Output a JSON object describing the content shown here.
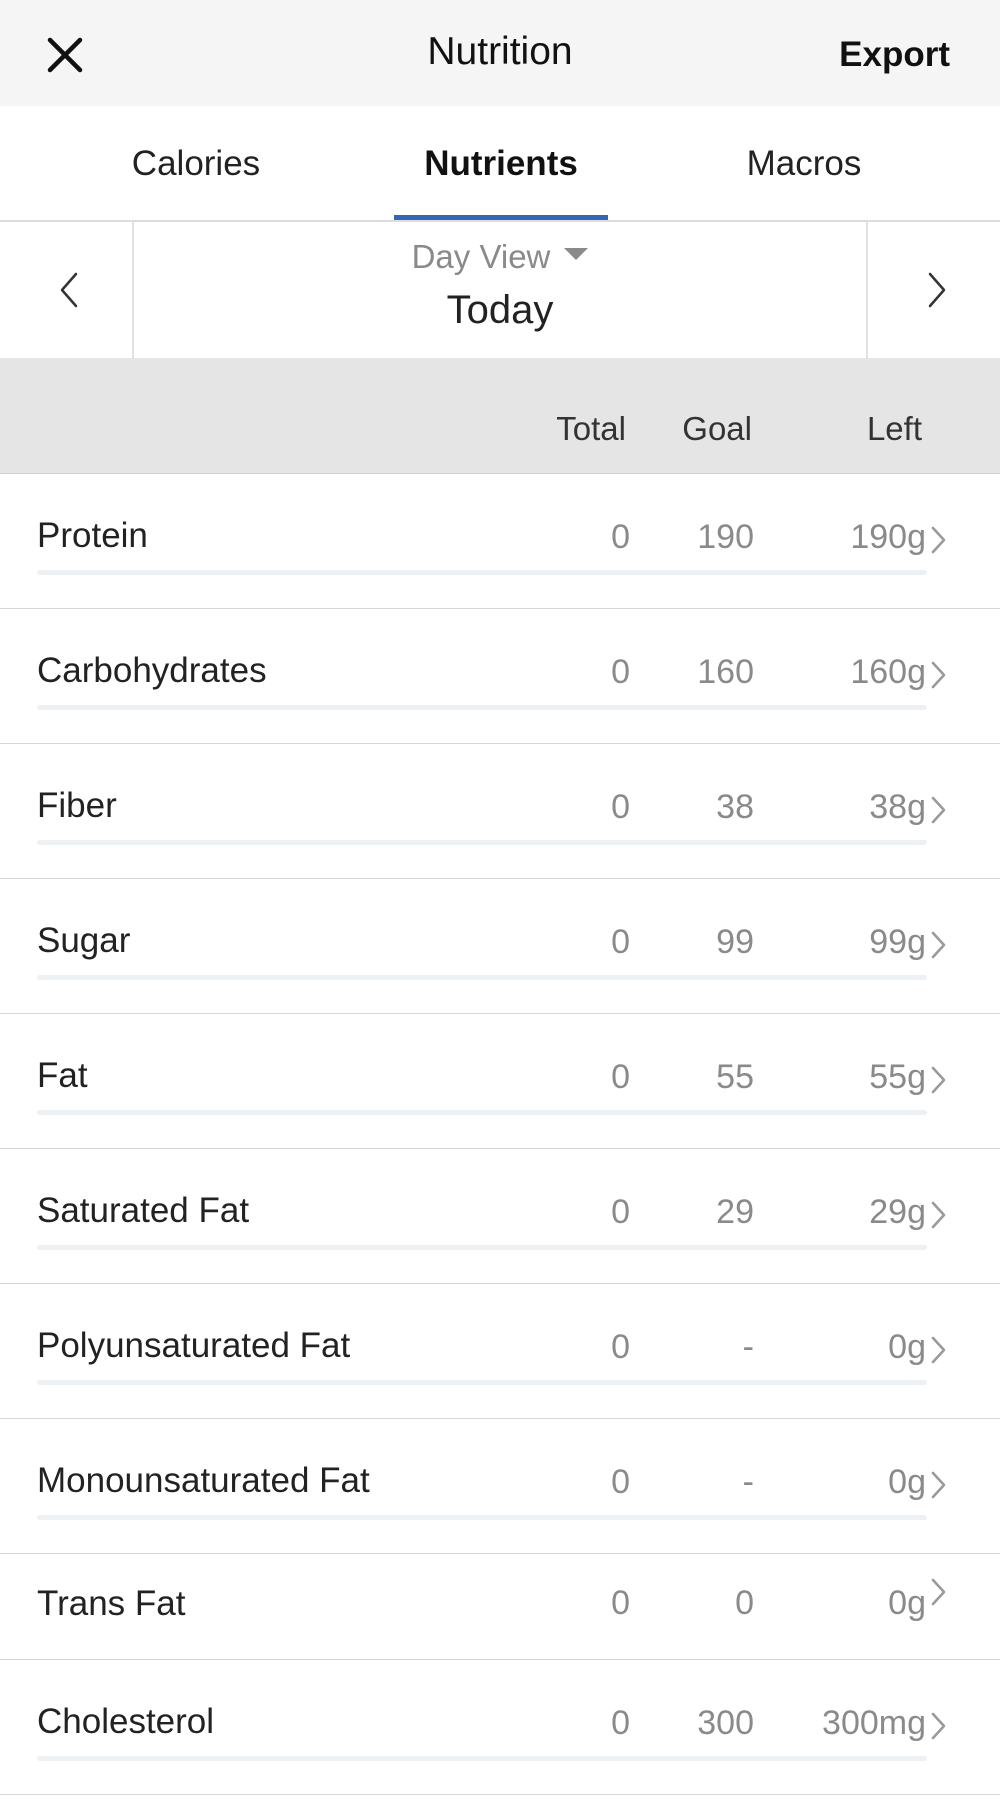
{
  "header": {
    "title": "Nutrition",
    "export_label": "Export",
    "close_icon": "close-icon"
  },
  "tabs": [
    {
      "label": "Calories",
      "active": false
    },
    {
      "label": "Nutrients",
      "active": true
    },
    {
      "label": "Macros",
      "active": false
    }
  ],
  "day_nav": {
    "view_label": "Day View",
    "day_label": "Today",
    "prev_icon": "chevron-left-icon",
    "next_icon": "chevron-right-icon"
  },
  "columns": {
    "total": "Total",
    "goal": "Goal",
    "left": "Left"
  },
  "colors": {
    "accent": "#3267b6",
    "header_bg": "#f5f5f5",
    "column_header_bg": "#e5e5e5",
    "muted_text": "#8a8a8a"
  },
  "nutrients": [
    {
      "name": "Protein",
      "total": "0",
      "goal": "190",
      "left": "190g",
      "progress": 0
    },
    {
      "name": "Carbohydrates",
      "total": "0",
      "goal": "160",
      "left": "160g",
      "progress": 0
    },
    {
      "name": "Fiber",
      "total": "0",
      "goal": "38",
      "left": "38g",
      "progress": 0
    },
    {
      "name": "Sugar",
      "total": "0",
      "goal": "99",
      "left": "99g",
      "progress": 0
    },
    {
      "name": "Fat",
      "total": "0",
      "goal": "55",
      "left": "55g",
      "progress": 0
    },
    {
      "name": "Saturated Fat",
      "total": "0",
      "goal": "29",
      "left": "29g",
      "progress": 0
    },
    {
      "name": "Polyunsaturated Fat",
      "total": "0",
      "goal": "-",
      "left": "0g",
      "progress": 0
    },
    {
      "name": "Monounsaturated Fat",
      "total": "0",
      "goal": "-",
      "left": "0g",
      "progress": 0
    },
    {
      "name": "Trans Fat",
      "total": "0",
      "goal": "0",
      "left": "0g",
      "progress": null
    },
    {
      "name": "Cholesterol",
      "total": "0",
      "goal": "300",
      "left": "300mg",
      "progress": 0
    }
  ]
}
